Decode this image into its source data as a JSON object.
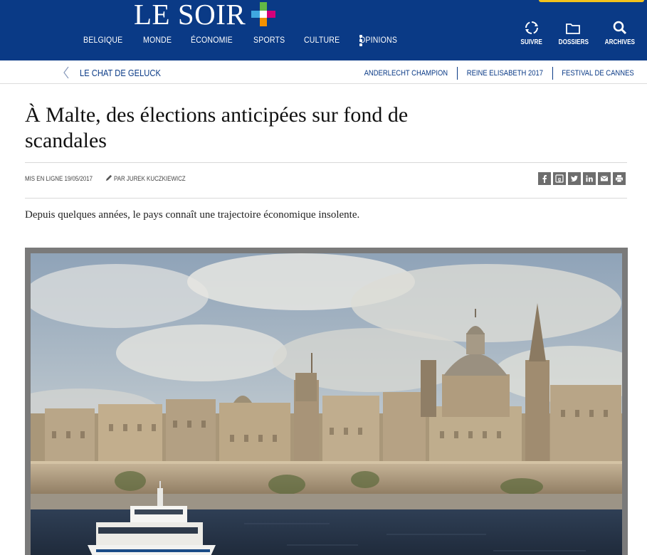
{
  "header": {
    "logo_text": "LE SOIR",
    "nav": [
      "BELGIQUE",
      "MONDE",
      "ÉCONOMIE",
      "SPORTS",
      "CULTURE",
      "OPINIONS"
    ],
    "tools": [
      {
        "label": "SUIVRE",
        "icon": "refresh-icon"
      },
      {
        "label": "DOSSIERS",
        "icon": "folder-icon"
      },
      {
        "label": "ARCHIVES",
        "icon": "search-icon"
      }
    ],
    "colors": {
      "brand": "#0a3a86",
      "accent_yellow": "#f4c21b",
      "plus_green": "#62b846",
      "plus_pink": "#d4007a",
      "plus_orange": "#f29100"
    }
  },
  "subnav": {
    "back_label": "LE CHAT DE GELUCK",
    "trends": [
      "ANDERLECHT CHAMPION",
      "REINE ELISABETH 2017",
      "FESTIVAL DE CANNES"
    ]
  },
  "article": {
    "title": "À Malte, des élections anticipées sur fond de scandales",
    "meta_date": "MIS EN LIGNE 19/05/2017",
    "meta_author": "PAR JUREK KUCZKIEWICZ",
    "share_icons": [
      "facebook-icon",
      "googleplus-icon",
      "twitter-icon",
      "linkedin-icon",
      "email-icon",
      "print-icon"
    ],
    "lead": "Depuis quelques années, le pays connaît une trajectoire économique insolente."
  }
}
